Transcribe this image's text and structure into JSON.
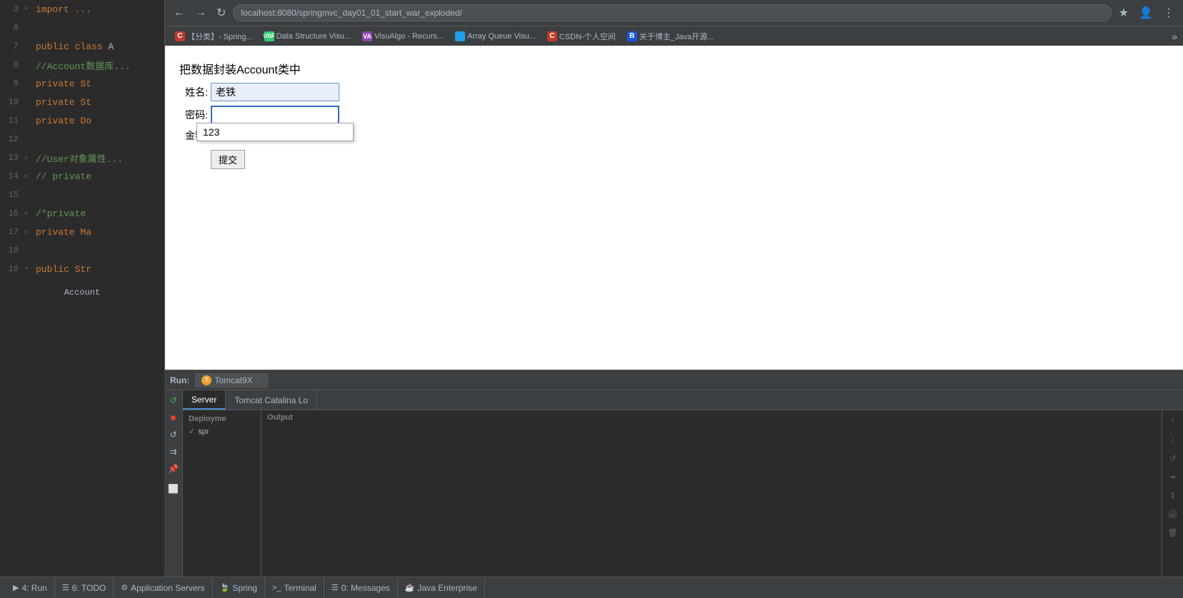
{
  "browser": {
    "back_label": "←",
    "forward_label": "→",
    "refresh_label": "↻",
    "url": "localhost:8080/springmvc_day01_01_start_war_exploded/",
    "star_icon": "★",
    "profile_icon": "👤",
    "more_icon": "⋮",
    "bookmarks": [
      {
        "id": "bm1",
        "favicon_class": "favicon-c",
        "favicon_text": "C",
        "label": "【分类】- Spring..."
      },
      {
        "id": "bm2",
        "favicon_class": "favicon-usf",
        "favicon_text": "USF",
        "label": "Data Structure Visu..."
      },
      {
        "id": "bm3",
        "favicon_class": "favicon-va",
        "favicon_text": "VA",
        "label": "VisuAlgo - Recurs..."
      },
      {
        "id": "bm4",
        "favicon_class": "favicon-globe",
        "favicon_text": "🌐",
        "label": "Array Queue Visu..."
      },
      {
        "id": "bm5",
        "favicon_class": "favicon-csdn",
        "favicon_text": "C",
        "label": "CSDN-个人空间"
      },
      {
        "id": "bm6",
        "favicon_class": "favicon-b",
        "favicon_text": "B",
        "label": "关于博主_Java开源..."
      }
    ]
  },
  "form": {
    "title": "把数据封装Account类中",
    "name_label": "姓名:",
    "name_value": "老铁",
    "password_label": "密码:",
    "password_value": "",
    "amount_label": "金额:",
    "autocomplete_value": "123",
    "submit_label": "提交"
  },
  "code": {
    "lines": [
      {
        "num": "3",
        "icon": "+",
        "text": "import ...",
        "class": "kw-import"
      },
      {
        "num": "6",
        "icon": "",
        "text": ""
      },
      {
        "num": "7",
        "icon": "",
        "text_parts": [
          {
            "text": "public class",
            "class": "kw-public"
          },
          {
            "text": " A",
            "class": ""
          }
        ]
      },
      {
        "num": "8",
        "icon": "",
        "comment": "//Account数据库...",
        "class": "kw-slash-comment"
      },
      {
        "num": "9",
        "icon": "",
        "text_parts": [
          {
            "text": "    private St",
            "class": "kw-private"
          }
        ]
      },
      {
        "num": "10",
        "icon": "",
        "text_parts": [
          {
            "text": "    private St",
            "class": "kw-private"
          }
        ]
      },
      {
        "num": "11",
        "icon": "",
        "text_parts": [
          {
            "text": "    private Do",
            "class": "kw-private"
          }
        ]
      },
      {
        "num": "12",
        "icon": "",
        "text": ""
      },
      {
        "num": "13",
        "icon": "◇",
        "comment": "//User对象属性...",
        "class": "kw-slash-comment"
      },
      {
        "num": "14",
        "icon": "◇",
        "comment": "//    private",
        "class": "kw-slash-comment"
      },
      {
        "num": "15",
        "icon": "",
        "text": ""
      },
      {
        "num": "16",
        "icon": "◇",
        "comment": "/*private",
        "class": "kw-slash-comment"
      },
      {
        "num": "17",
        "icon": "◇",
        "text_parts": [
          {
            "text": "    private Ma",
            "class": "kw-private"
          }
        ]
      },
      {
        "num": "18",
        "icon": "",
        "text": ""
      },
      {
        "num": "19",
        "icon": "+",
        "text_parts": [
          {
            "text": "    public Str",
            "class": "kw-public"
          }
        ]
      }
    ],
    "account_label": "Account"
  },
  "run": {
    "label": "Run:",
    "tab_label": "Tomcat9X",
    "tab_close": "×",
    "server_tab": "Server",
    "catalina_tab": "Tomcat Catalina Lo",
    "deployment_header": "Deployme",
    "output_header": "Output",
    "deployment_item": "✓ spr",
    "green_check": "✓"
  },
  "statusbar": {
    "tabs": [
      {
        "id": "tab-run",
        "icon": "▶",
        "label": "4: Run"
      },
      {
        "id": "tab-todo",
        "icon": "☰",
        "label": "6: TODO"
      },
      {
        "id": "tab-appservers",
        "icon": "⚙",
        "label": "Application Servers"
      },
      {
        "id": "tab-spring",
        "icon": "🍃",
        "label": "Spring"
      },
      {
        "id": "tab-terminal",
        "icon": ">_",
        "label": "Terminal"
      },
      {
        "id": "tab-messages",
        "icon": "☰",
        "label": "0: Messages"
      },
      {
        "id": "tab-java",
        "icon": "☕",
        "label": "Java Enterprise"
      }
    ]
  },
  "output_toolbar": {
    "buttons": [
      "↑",
      "↓",
      "↺",
      "⇉",
      "↕",
      "🖨",
      "🗑"
    ]
  }
}
